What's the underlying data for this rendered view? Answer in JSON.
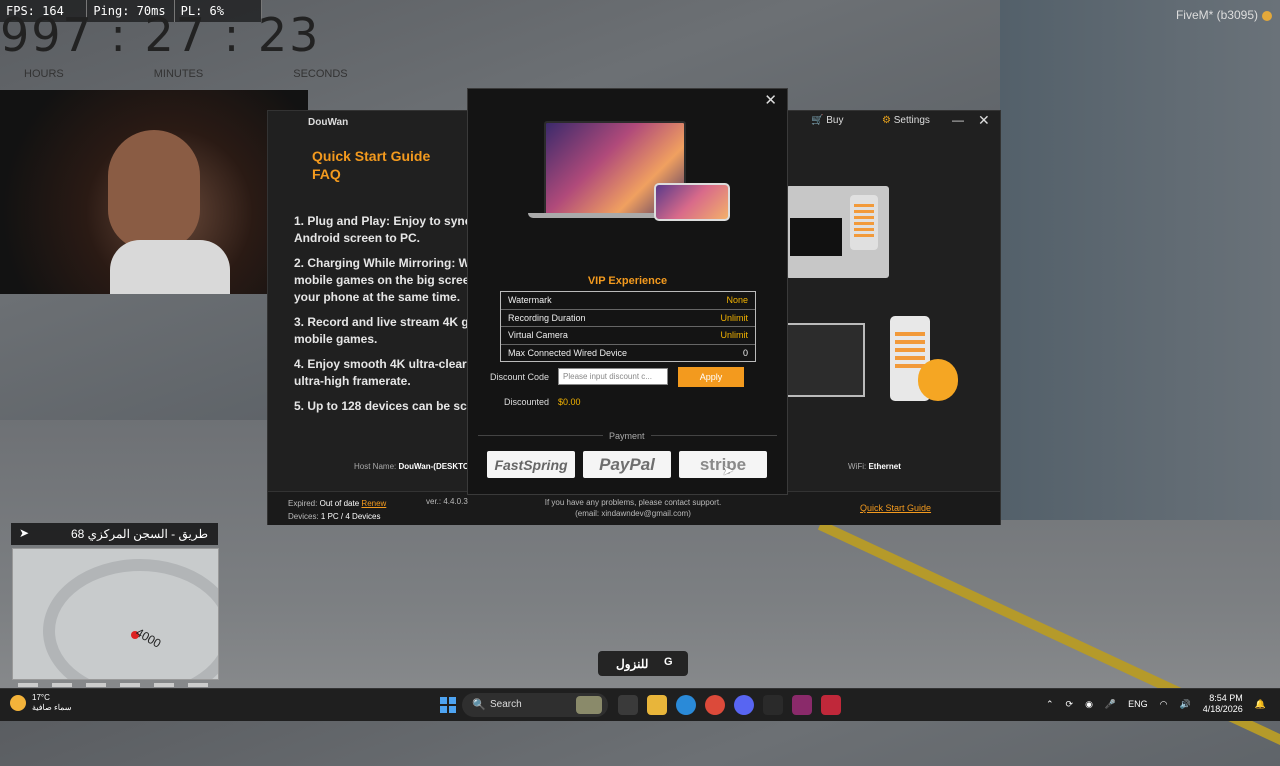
{
  "hud": {
    "fps": "FPS: 164",
    "ping": "Ping: 70ms",
    "pl": "PL: 6%",
    "timer": "997 : 27 : 23",
    "labels": [
      "HOURS",
      "MINUTES",
      "SECONDS"
    ],
    "fivem": "FiveM* (b3095)"
  },
  "app": {
    "title": "DouWan",
    "buy": "Buy",
    "settings": "Settings",
    "quick_start": "Quick Start Guide",
    "faq": "FAQ",
    "features": [
      "1. Plug and Play: Enjoy to sync Android screen to PC.",
      "2. Charging While Mirroring: W mobile games on the big scree your phone at the same time.",
      "3. Record and live stream 4K g mobile games.",
      "4. Enjoy smooth 4K ultra-clear ultra-high framerate.",
      "5. Up to 128 devices can be scr"
    ],
    "host_label": "Host Name:",
    "host_value": "DouWan-(DESKTO",
    "wifi_label": "WiFi:",
    "wifi_value": "Ethernet",
    "expired_label": "Expired:",
    "expired_value": "Out of date",
    "renew": "Renew",
    "devices_label": "Devices:",
    "devices_value": "1 PC / 4 Devices",
    "version": "ver.: 4.4.0.3",
    "support_line1": "If you have any problems, please contact support.",
    "support_line2": "(email: xindawndev@gmail.com)",
    "guide_link": "Quick Start Guide"
  },
  "vip": {
    "title": "VIP Experience",
    "rows": [
      {
        "k": "Watermark",
        "v": "None"
      },
      {
        "k": "Recording Duration",
        "v": "Unlimit"
      },
      {
        "k": "Virtual Camera",
        "v": "Unlimit"
      },
      {
        "k": "Max Connected Wired Device",
        "v": "0"
      }
    ],
    "discount_label": "Discount Code",
    "discount_placeholder": "Please input discount c...",
    "apply": "Apply",
    "discounted_label": "Discounted",
    "discounted_value": "$0.00",
    "payment_label": "Payment",
    "pay_options": [
      "FastSpring",
      "PayPal",
      "stripe"
    ]
  },
  "game": {
    "street": "68 طريق - السجن المركزي",
    "map_label": "4000",
    "prompt_text": "للنزول",
    "prompt_key": "G"
  },
  "taskbar": {
    "temp": "17°C",
    "condition": "سماء صافية",
    "search": "Search",
    "lang": "ENG",
    "time": "8:54 PM",
    "date": "4/18/2026"
  },
  "colors": {
    "accent": "#f39a1e",
    "value": "#f3b300"
  }
}
